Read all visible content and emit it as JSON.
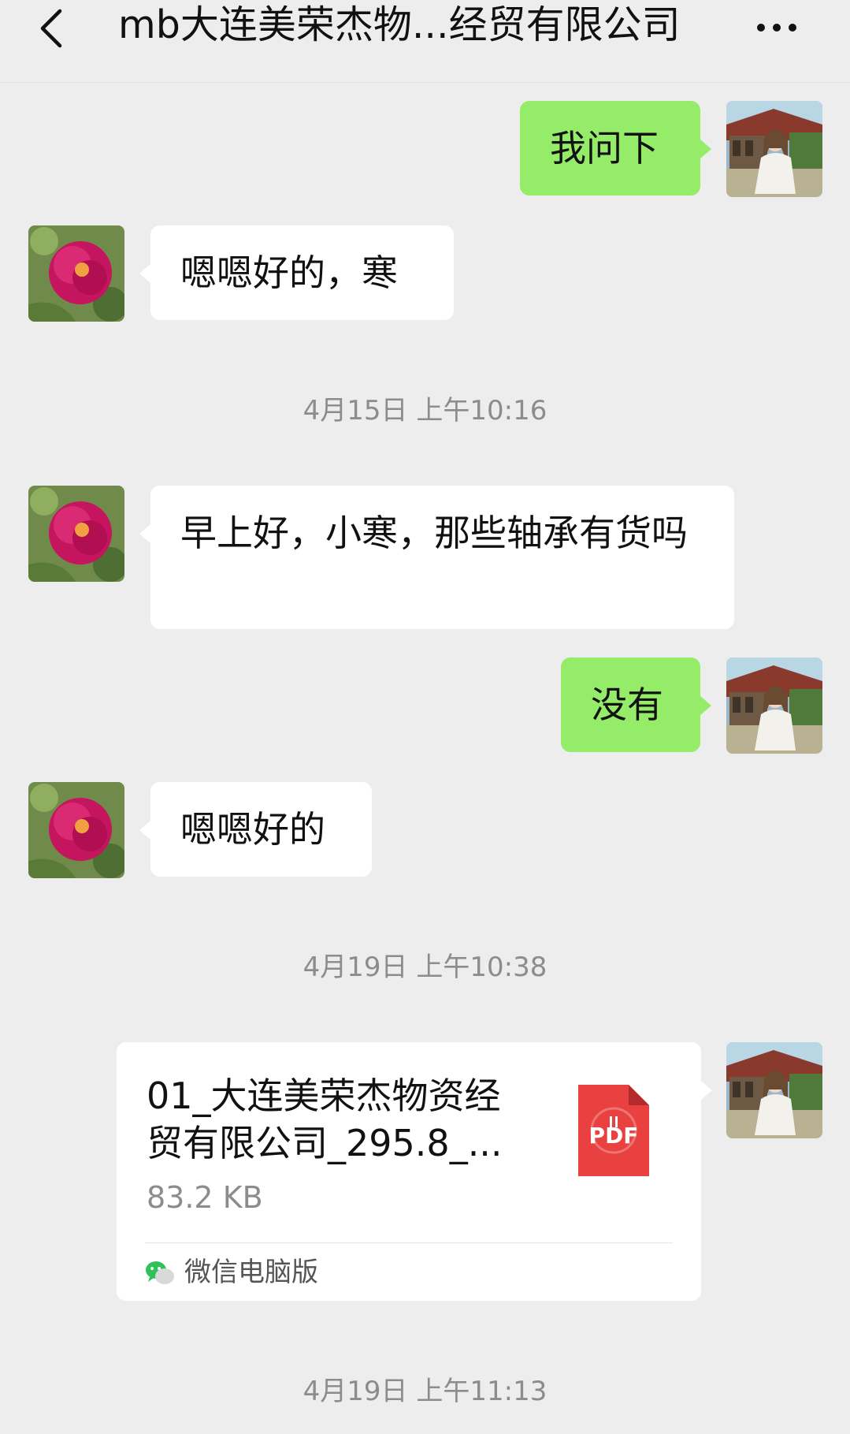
{
  "header": {
    "title": "mb大连美荣杰物...经贸有限公司",
    "back_icon": "chevron-left-icon",
    "more_icon": "ellipsis-icon"
  },
  "messages": [
    {
      "sender": "self",
      "text": "我问下"
    },
    {
      "sender": "contact",
      "text": "嗯嗯好的，寒"
    },
    {
      "sender": "contact",
      "text": "早上好，小寒，那些轴承有货吗"
    },
    {
      "sender": "self",
      "text": "没有"
    },
    {
      "sender": "contact",
      "text": "嗯嗯好的"
    }
  ],
  "timestamps": [
    "4月15日 上午10:16",
    "4月19日 上午10:38",
    "4月19日 上午11:13"
  ],
  "file_message": {
    "name_line1": "01_大连美荣杰物资经",
    "name_line2": "贸有限公司_295.8_...",
    "size": "83.2 KB",
    "file_type_icon": "pdf-file-icon",
    "source": "微信电脑版",
    "source_icon": "wechat-icon"
  },
  "colors": {
    "background": "#ededed",
    "self_bubble": "#95ec69",
    "contact_bubble": "#ffffff",
    "timestamp_text": "#8c8c8c",
    "pdf_red": "#e94040"
  }
}
